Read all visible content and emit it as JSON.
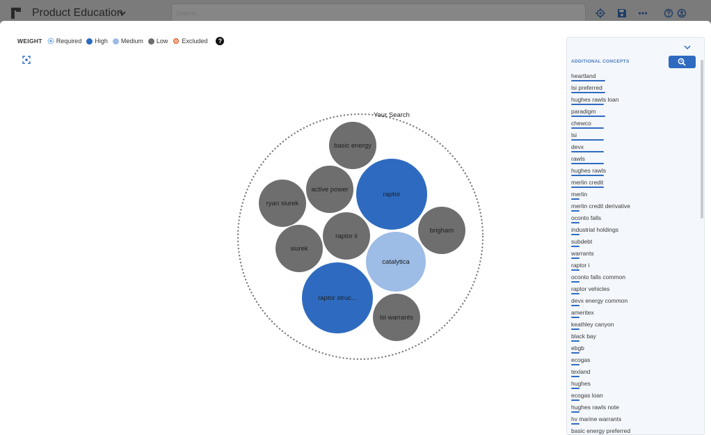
{
  "header": {
    "app_title": "Product Education",
    "search_placeholder": "Search..."
  },
  "legend": {
    "weight_label": "WEIGHT",
    "items": [
      {
        "label": "Required",
        "color": "#5b9bd5"
      },
      {
        "label": "High",
        "color": "#2e6bc0"
      },
      {
        "label": "Medium",
        "color": "#9dbce6"
      },
      {
        "label": "Low",
        "color": "#6e6e6e"
      },
      {
        "label": "Excluded",
        "color": "#e2622b"
      }
    ],
    "help_symbol": "?"
  },
  "bubble_chart": {
    "container_label": "Your Search",
    "bubbles": [
      {
        "label": "basic energy",
        "weight": "Low"
      },
      {
        "label": "raptor",
        "weight": "High"
      },
      {
        "label": "active power",
        "weight": "Low"
      },
      {
        "label": "ryan siurek",
        "weight": "Low"
      },
      {
        "label": "brigham",
        "weight": "Low"
      },
      {
        "label": "raptor ii",
        "weight": "Low"
      },
      {
        "label": "siurek",
        "weight": "Low"
      },
      {
        "label": "catalytica",
        "weight": "Medium"
      },
      {
        "label": "raptor struc...",
        "weight": "High"
      },
      {
        "label": "lsi warrants",
        "weight": "Low"
      }
    ]
  },
  "panel": {
    "heading": "ADDITIONAL CONCEPTS",
    "concepts": [
      {
        "label": "heartland",
        "score": 0.28
      },
      {
        "label": "lsi preferred",
        "score": 0.28
      },
      {
        "label": "hughes rawls loan",
        "score": 0.27
      },
      {
        "label": "paradigm",
        "score": 0.28
      },
      {
        "label": "chewco",
        "score": 0.27
      },
      {
        "label": "lsi",
        "score": 0.27
      },
      {
        "label": "devx",
        "score": 0.27
      },
      {
        "label": "rawls",
        "score": 0.27
      },
      {
        "label": "hughes rawls",
        "score": 0.27
      },
      {
        "label": "merlin credit",
        "score": 0.27
      },
      {
        "label": "merlin",
        "score": 0.07
      },
      {
        "label": "merlin credit derivative",
        "score": 0.07
      },
      {
        "label": "oconto falls",
        "score": 0.07
      },
      {
        "label": "industrial holdings",
        "score": 0.07
      },
      {
        "label": "subdebt",
        "score": 0.07
      },
      {
        "label": "warrants",
        "score": 0.07
      },
      {
        "label": "raptor i",
        "score": 0.07
      },
      {
        "label": "oconto falls common",
        "score": 0.07
      },
      {
        "label": "raptor vehicles",
        "score": 0.07
      },
      {
        "label": "devx energy common",
        "score": 0.07
      },
      {
        "label": "ameritex",
        "score": 0.07
      },
      {
        "label": "keathley canyon",
        "score": 0.07
      },
      {
        "label": "black bay",
        "score": 0.07
      },
      {
        "label": "ebgb",
        "score": 0.07
      },
      {
        "label": "ecogas",
        "score": 0.07
      },
      {
        "label": "texland",
        "score": 0.07
      },
      {
        "label": "hughes",
        "score": 0.07
      },
      {
        "label": "ecogas loan",
        "score": 0.07
      },
      {
        "label": "hughes rawls note",
        "score": 0.07
      },
      {
        "label": "hv marine warrants",
        "score": 0.07
      },
      {
        "label": "basic energy preferred",
        "score": 0.07
      }
    ]
  },
  "colors": {
    "high": "#2e6bc0",
    "medium": "#9dbce6",
    "low": "#6e6e6e",
    "accent": "#2e6bc0"
  }
}
